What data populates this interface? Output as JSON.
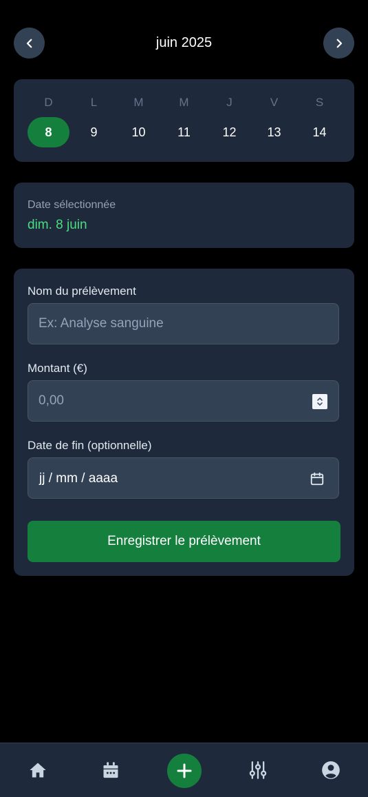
{
  "header": {
    "month_title": "juin 2025",
    "prev_icon": "chevron-left-icon",
    "next_icon": "chevron-right-icon"
  },
  "week": {
    "days": [
      {
        "letter": "D",
        "number": "8",
        "selected": true
      },
      {
        "letter": "L",
        "number": "9",
        "selected": false
      },
      {
        "letter": "M",
        "number": "10",
        "selected": false
      },
      {
        "letter": "M",
        "number": "11",
        "selected": false
      },
      {
        "letter": "J",
        "number": "12",
        "selected": false
      },
      {
        "letter": "V",
        "number": "13",
        "selected": false
      },
      {
        "letter": "S",
        "number": "14",
        "selected": false
      }
    ]
  },
  "selected_date": {
    "label": "Date sélectionnée",
    "value": "dim. 8 juin"
  },
  "form": {
    "name_label": "Nom du prélèvement",
    "name_placeholder": "Ex: Analyse sanguine",
    "name_value": "",
    "amount_label": "Montant (€)",
    "amount_placeholder": "0,00",
    "amount_value": "",
    "end_date_label": "Date de fin (optionnelle)",
    "end_date_value": "jj / mm / aaaa",
    "submit_label": "Enregistrer le prélèvement"
  },
  "bottom_nav": {
    "items": [
      {
        "icon": "home-icon"
      },
      {
        "icon": "calendar-icon"
      },
      {
        "icon": "plus-icon"
      },
      {
        "icon": "sliders-icon"
      },
      {
        "icon": "user-icon"
      }
    ]
  },
  "colors": {
    "background": "#000000",
    "card": "#1e293b",
    "input": "#334155",
    "accent": "#15803d",
    "accent_text": "#4ade80",
    "muted": "#94a3b8"
  }
}
